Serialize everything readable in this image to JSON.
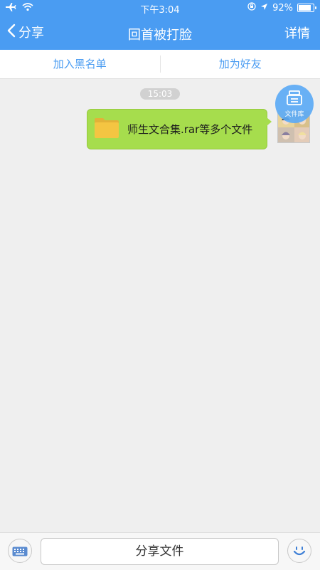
{
  "status_bar": {
    "time": "下午3:04",
    "battery": "92%",
    "battery_level": 0.92
  },
  "nav": {
    "back_label": "分享",
    "title": "回首被打脸",
    "details_label": "详情"
  },
  "actions": {
    "blacklist_label": "加入黑名单",
    "add_friend_label": "加为好友"
  },
  "chat": {
    "timestamp": "15:03",
    "message_text": "师生文合集.rar等多个文件",
    "file_library_label": "文件库"
  },
  "bottom_bar": {
    "share_label": "分享文件"
  },
  "colors": {
    "header": "#4a9cf2",
    "bubble": "#a6dd4d",
    "folder": "#f4c542"
  },
  "icons": {
    "airplane": "airplane-icon",
    "wifi": "wifi-icon",
    "lock": "rotation-lock-icon",
    "location": "location-arrow-icon",
    "back": "chevron-left-icon",
    "folder": "folder-icon",
    "library": "file-library-icon",
    "keyboard": "keyboard-icon",
    "emoji": "smiley-icon"
  }
}
